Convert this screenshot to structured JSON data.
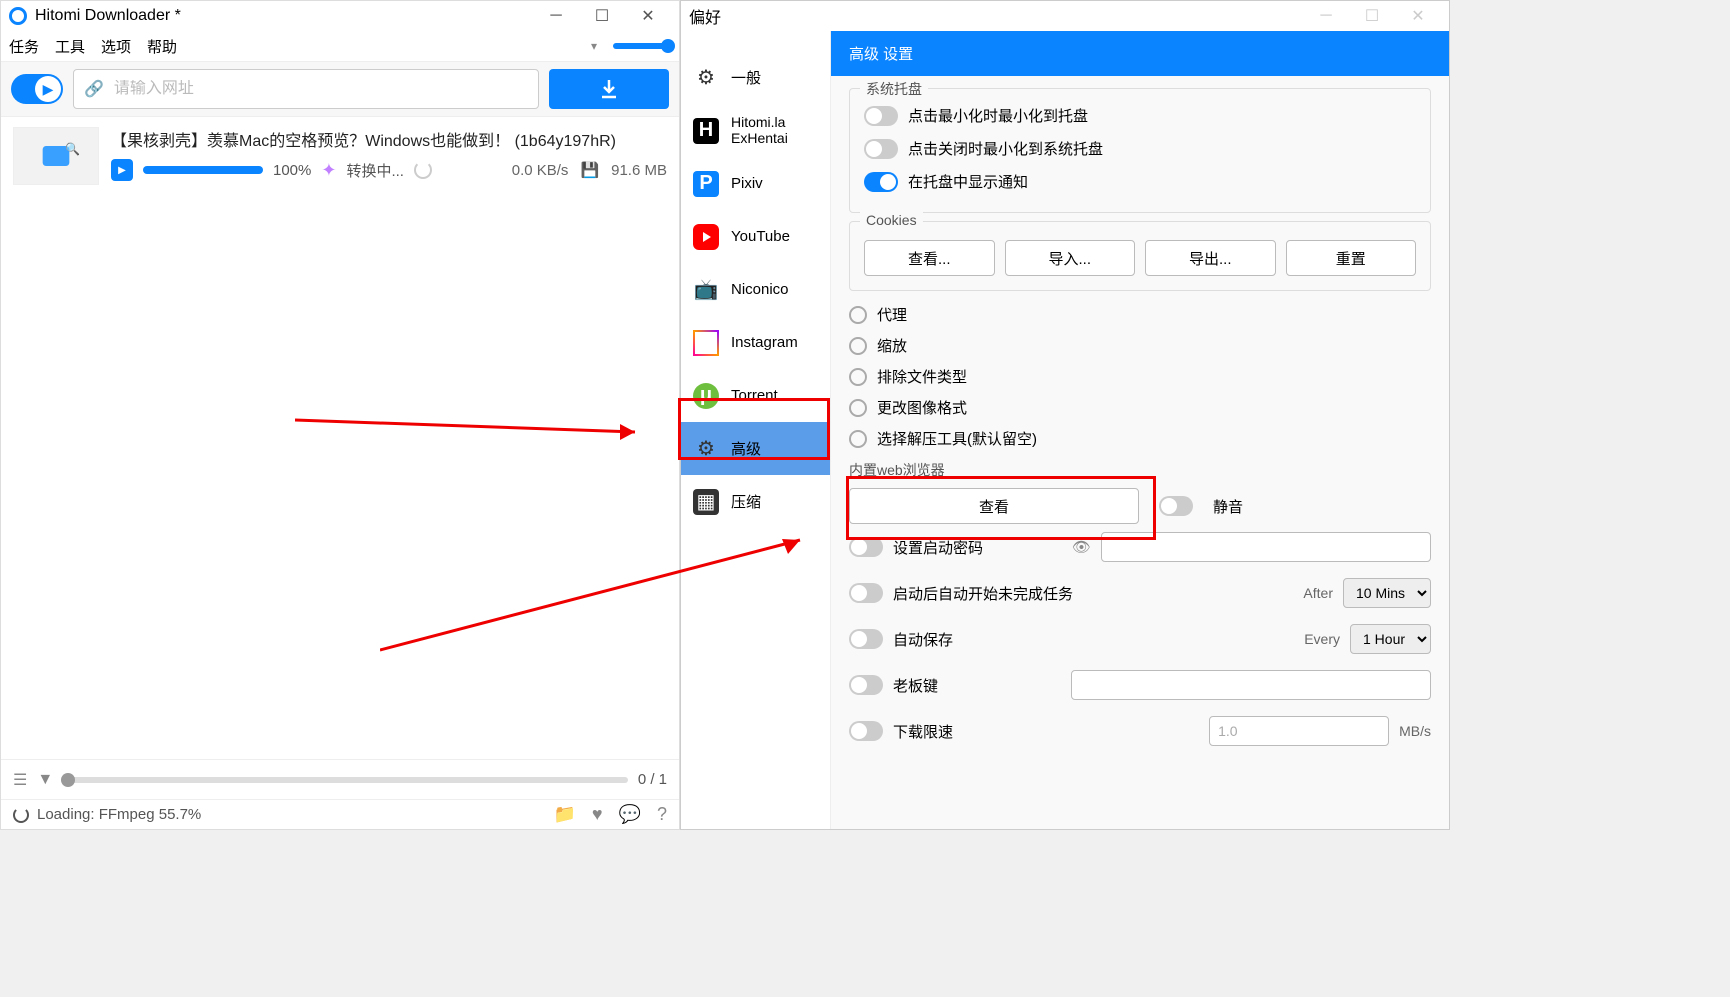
{
  "main": {
    "title": "Hitomi Downloader *",
    "menu": {
      "tasks": "任务",
      "tools": "工具",
      "options": "选项",
      "help": "帮助"
    },
    "url_placeholder": "请输入网址",
    "task": {
      "title": "【果核剥壳】羡慕Mac的空格预览？Windows也能做到！ (1b64y197hR)",
      "percent": "100%",
      "status": "转换中...",
      "speed": "0.0 KB/s",
      "size": "91.6 MB"
    },
    "counter": "0 / 1",
    "loading": "Loading: FFmpeg 55.7%"
  },
  "pref": {
    "title": "偏好",
    "sidebar": {
      "general": "一般",
      "hitomi": "Hitomi.la\nExHentai",
      "pixiv": "Pixiv",
      "youtube": "YouTube",
      "niconico": "Niconico",
      "instagram": "Instagram",
      "torrent": "Torrent",
      "advanced": "高级",
      "compress": "压缩"
    },
    "header": "高级  设置",
    "tray": {
      "legend": "系统托盘",
      "minimize": "点击最小化时最小化到托盘",
      "close": "点击关闭时最小化到系统托盘",
      "notify": "在托盘中显示通知"
    },
    "cookies": {
      "legend": "Cookies",
      "view": "查看...",
      "import": "导入...",
      "export": "导出...",
      "reset": "重置"
    },
    "radios": {
      "proxy": "代理",
      "zoom": "缩放",
      "exclude": "排除文件类型",
      "format": "更改图像格式",
      "extract": "选择解压工具(默认留空)"
    },
    "browser": {
      "legend": "内置web浏览器",
      "view": "查看",
      "mute": "静音"
    },
    "opts": {
      "password": "设置启动密码",
      "resume": "启动后自动开始未完成任务",
      "autosave": "自动保存",
      "boss": "老板键",
      "limit": "下载限速",
      "after": "After",
      "every": "Every",
      "after_val": "10 Mins",
      "every_val": "1 Hour",
      "limit_val": "1.0",
      "limit_unit": "MB/s"
    }
  }
}
